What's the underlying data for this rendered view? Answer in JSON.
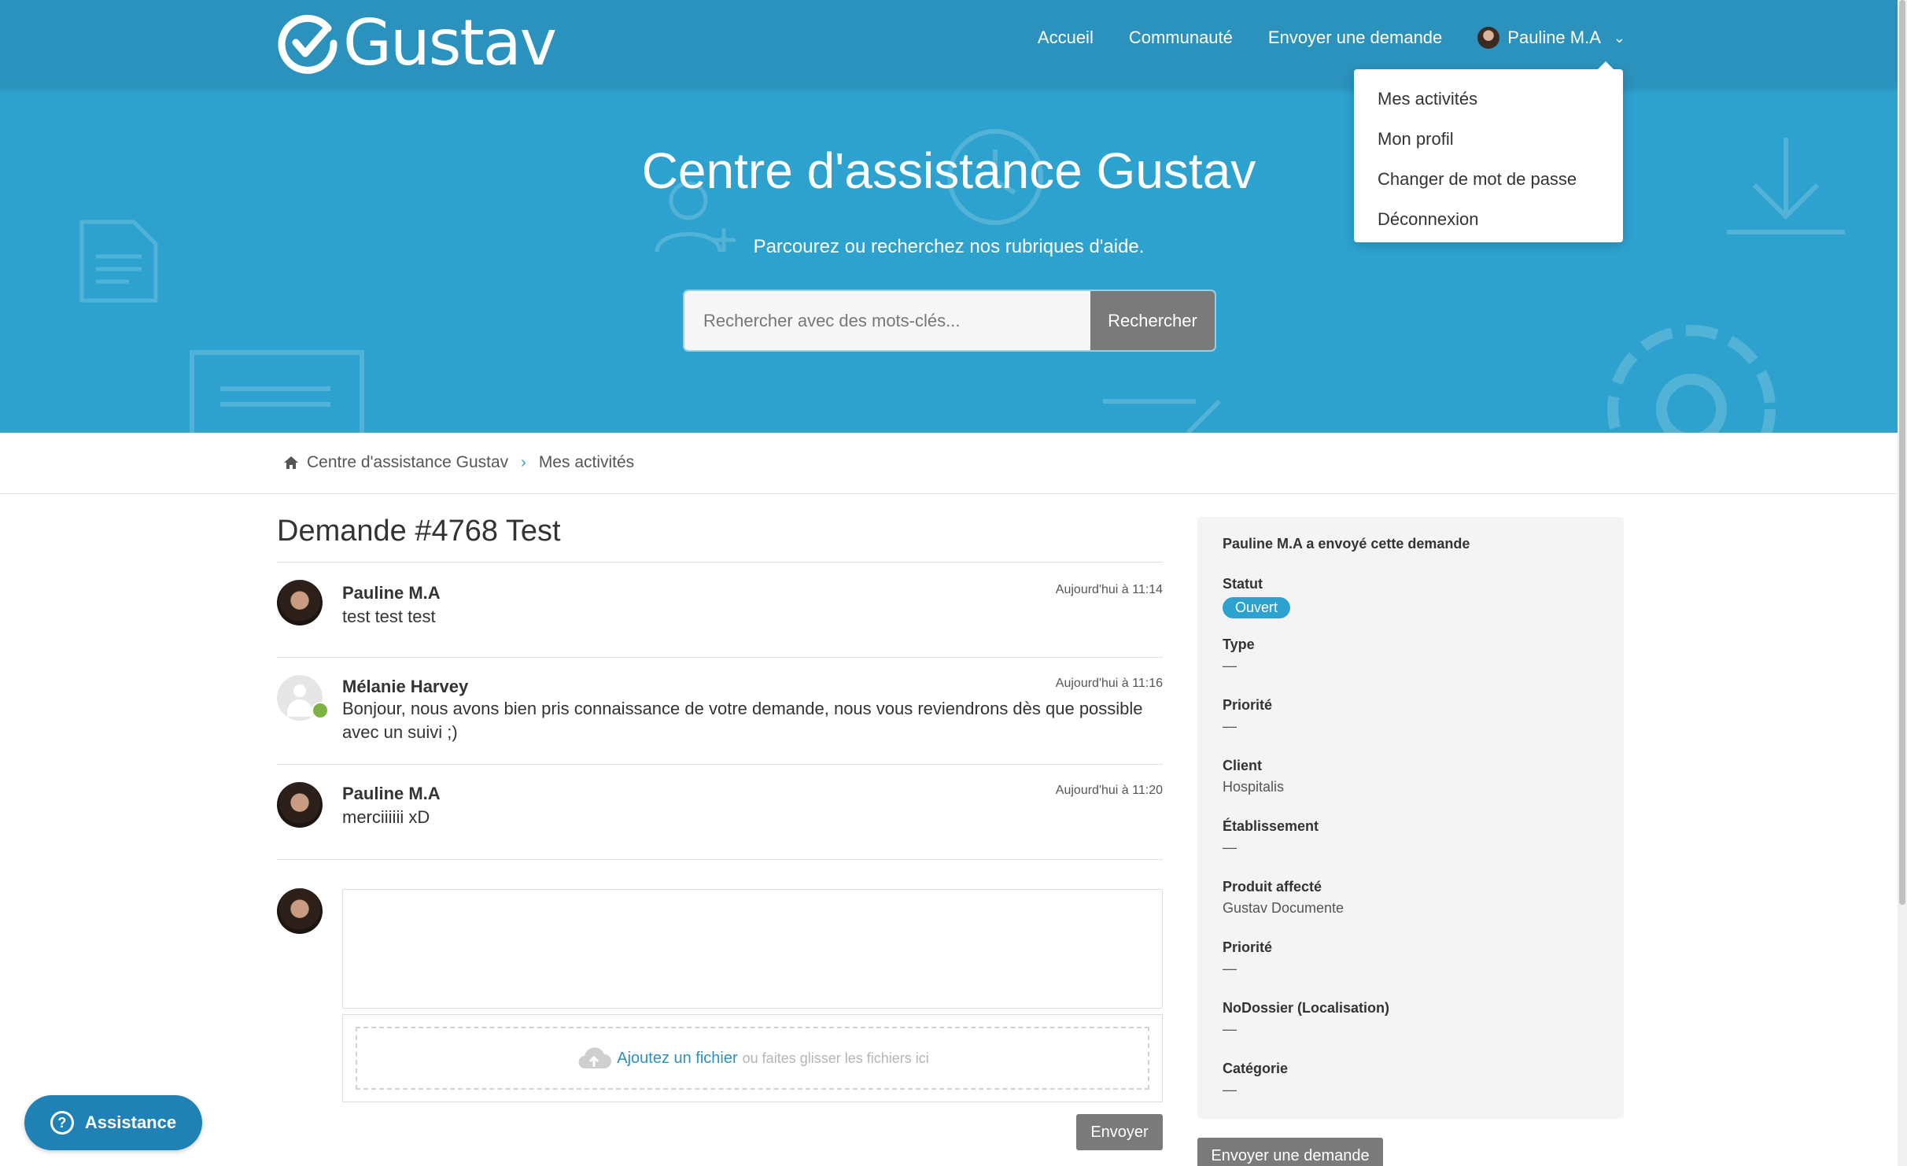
{
  "brand": {
    "name": "Gustav"
  },
  "nav": {
    "items": [
      "Accueil",
      "Communauté",
      "Envoyer une demande"
    ],
    "user_name": "Pauline M.A"
  },
  "user_menu": {
    "items": [
      "Mes activités",
      "Mon profil",
      "Changer de mot de passe",
      "Déconnexion"
    ]
  },
  "hero": {
    "title": "Centre d'assistance Gustav",
    "subtitle": "Parcourez ou recherchez nos rubriques d'aide.",
    "search_placeholder": "Rechercher avec des mots-clés...",
    "search_button": "Rechercher"
  },
  "breadcrumb": [
    "Centre d'assistance Gustav",
    "Mes activités"
  ],
  "request": {
    "title": "Demande #4768 Test",
    "comments": [
      {
        "author": "Pauline M.A",
        "time": "Aujourd'hui à 11:14",
        "body": "test test test"
      },
      {
        "author": "Mélanie Harvey",
        "time": "Aujourd'hui à 11:16",
        "body": "Bonjour, nous avons bien pris connaissance de votre demande, nous vous reviendrons dès que possible avec un suivi ;)"
      },
      {
        "author": "Pauline M.A",
        "time": "Aujourd'hui à 11:20",
        "body": "merciiiiii xD"
      }
    ],
    "upload_link": "Ajoutez un fichier",
    "upload_hint": "ou faites glisser les fichiers ici",
    "send_button": "Envoyer"
  },
  "sidebar": {
    "heading": "Pauline M.A a envoyé cette demande",
    "fields": [
      {
        "label": "Statut",
        "value": "Ouvert"
      },
      {
        "label": "Type",
        "value": "—"
      },
      {
        "label": "Priorité",
        "value": "—"
      },
      {
        "label": "Client",
        "value": "Hospitalis"
      },
      {
        "label": "Établissement",
        "value": "—"
      },
      {
        "label": "Produit affecté",
        "value": "Gustav Documente"
      },
      {
        "label": "Priorité",
        "value": "—"
      },
      {
        "label": "NoDossier (Localisation)",
        "value": "—"
      },
      {
        "label": "Catégorie",
        "value": "—"
      }
    ],
    "send_button": "Envoyer une demande"
  },
  "help_widget": {
    "label": "Assistance"
  },
  "colors": {
    "primary": "#2da2cf",
    "topbar": "#2b92bd",
    "button_gray": "#7a7a7a",
    "help": "#1f81b4"
  }
}
